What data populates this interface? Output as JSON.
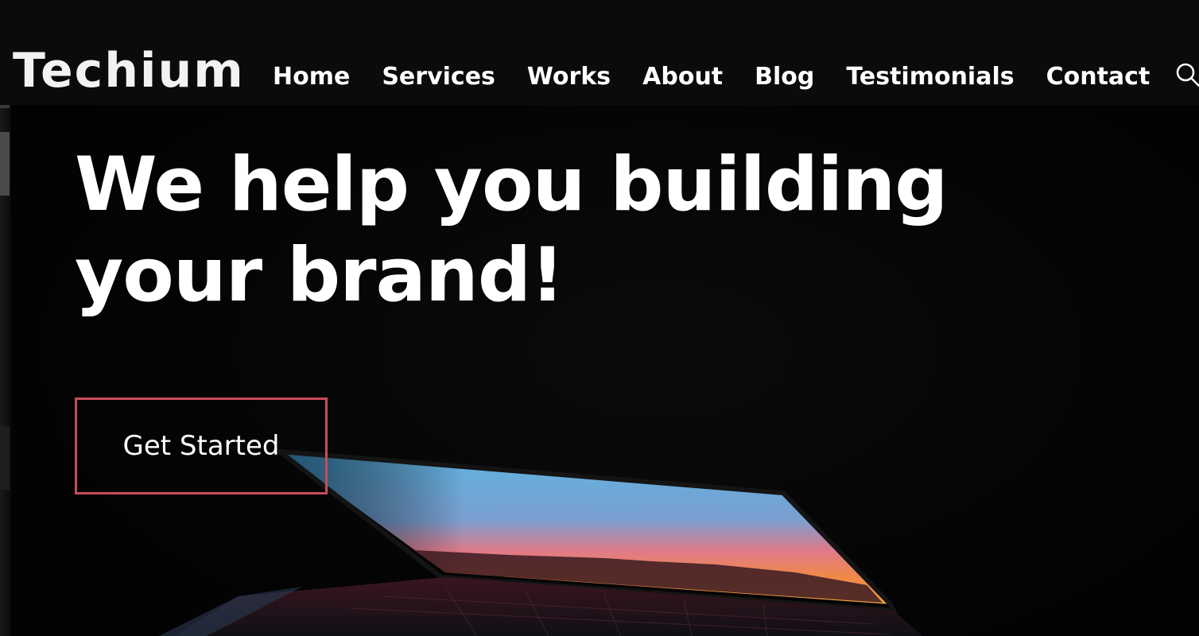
{
  "brand": {
    "logo_text": "Techium"
  },
  "nav": {
    "items": [
      {
        "label": "Home"
      },
      {
        "label": "Services"
      },
      {
        "label": "Works"
      },
      {
        "label": "About"
      },
      {
        "label": "Blog"
      },
      {
        "label": "Testimonials"
      },
      {
        "label": "Contact"
      }
    ],
    "search_icon": "search-icon"
  },
  "hero": {
    "title": "We help you building your brand!",
    "cta_label": "Get Started"
  },
  "colors": {
    "background": "#030303",
    "topbar": "#0b0b0b",
    "text": "#ffffff",
    "cta_border": "#c64d5c"
  }
}
